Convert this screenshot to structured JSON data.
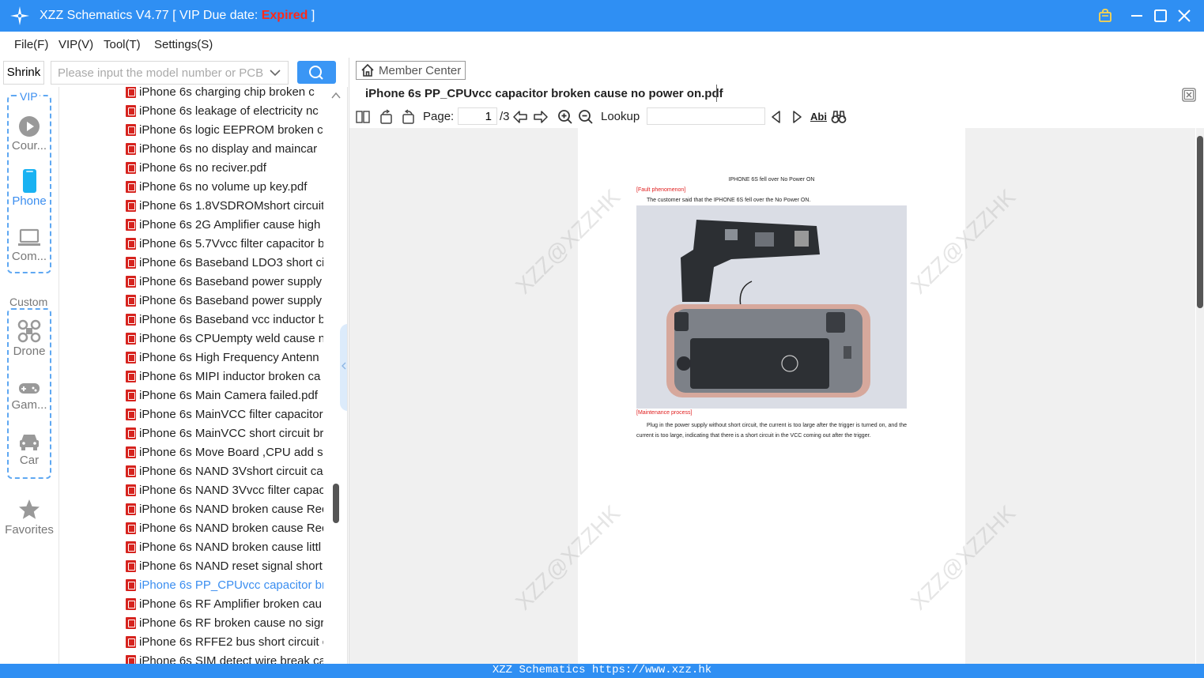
{
  "titlebar": {
    "title_prefix": "XZZ Schematics V4.77 [ VIP Due date: ",
    "expired": "Expired",
    "title_suffix": " ]",
    "accent_color": "#2f8ff3",
    "expired_color": "#ff2a1a"
  },
  "menu": [
    "File(F)",
    "VIP(V)",
    "Tool(T)",
    "Settings(S)"
  ],
  "search": {
    "shrink_label": "Shrink",
    "placeholder": "Please input the model number or PCB"
  },
  "sidebar": {
    "vip_group": "VIP",
    "custom_group": "Custom",
    "items": [
      {
        "label": "Cour...",
        "icon": "play-icon",
        "active": false
      },
      {
        "label": "Phone",
        "icon": "phone-icon",
        "active": true
      },
      {
        "label": "Com...",
        "icon": "laptop-icon",
        "active": false
      },
      {
        "label": "Drone",
        "icon": "drone-icon",
        "active": false
      },
      {
        "label": "Gam...",
        "icon": "gamepad-icon",
        "active": false
      },
      {
        "label": "Car",
        "icon": "car-icon",
        "active": false
      },
      {
        "label": "Favorites",
        "icon": "star-icon",
        "active": false
      }
    ]
  },
  "files": [
    "iPhone 6s  charging chip broken c",
    "iPhone 6s  leakage of electricity nc",
    "iPhone 6s  logic EEPROM broken c",
    "iPhone 6s  no display and maincar",
    "iPhone 6s  no reciver.pdf",
    "iPhone 6s  no volume up key.pdf",
    "iPhone 6s 1.8VSDROMshort circuit",
    "iPhone 6s 2G Amplifier cause high",
    "iPhone 6s 5.7Vvcc filter capacitor b",
    "iPhone 6s Baseband LDO3 short ci",
    "iPhone 6s Baseband power supply",
    "iPhone 6s Baseband power supply",
    "iPhone 6s Baseband vcc inductor b",
    "iPhone 6s CPUempty weld cause n",
    "iPhone 6s High Frequency Antenn",
    "iPhone 6s MIPI inductor broken ca",
    "iPhone 6s Main Camera failed.pdf",
    "iPhone 6s MainVCC filter capacitor",
    "iPhone 6s MainVCC short circuit br",
    "iPhone 6s Move Board ,CPU add sc",
    "iPhone 6s NAND 3Vshort circuit ca",
    "iPhone 6s NAND 3Vvcc filter capac",
    "iPhone 6s NAND broken cause Rec",
    "iPhone 6s NAND broken cause Rec",
    "iPhone 6s NAND broken cause littl",
    "iPhone 6s NAND reset signal short",
    "iPhone 6s PP_CPUvcc capacitor bro",
    "iPhone 6s RF Amplifier broken cau",
    "iPhone 6s RF broken cause no sigr",
    "iPhone 6s RFFE2 bus short circuit c",
    "iPhone 6s SIM detect wire break ca"
  ],
  "selected_file_index": 26,
  "viewer": {
    "member_center": "Member Center",
    "doc_title": "iPhone 6s PP_CPUvcc capacitor broken cause no power on.pdf",
    "page_label": "Page:",
    "page_current": "1",
    "page_total": "/3",
    "lookup_label": "Lookup",
    "find_icon_text": "Abi"
  },
  "document": {
    "heading": "IPHONE 6S fell over No Power ON",
    "fault_label": "[Fault phenomenon]",
    "fault_text": "The customer said that the IPHONE 6S fell over the No Power ON.",
    "process_label": "[Maintenance process]",
    "process_text": "Plug in the power supply without short circuit, the current is too large after the trigger is turned on, and the current is too large, indicating that there is a short circuit in the VCC coming out after the trigger.",
    "watermark": "XZZ@XZZHK",
    "label_color": "#e02020"
  },
  "statusbar": {
    "text": "XZZ Schematics https://www.xzz.hk"
  }
}
